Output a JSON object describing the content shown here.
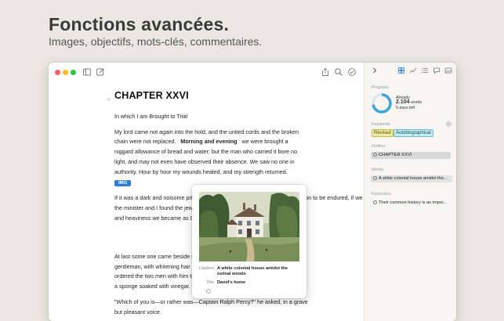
{
  "promo": {
    "title": "Fonctions avancées.",
    "subtitle": "Images, objectifs, mots-clés, commentaires."
  },
  "toolbar": {
    "left_icons": [
      "sidebar-icon",
      "compose-icon"
    ],
    "right_icons": [
      "share-icon",
      "search-icon",
      "checkmark-circle-icon"
    ]
  },
  "document": {
    "heading_marker": "##",
    "chapter_title": "CHAPTER XXVI",
    "subtitle": "In which I am Brought to Trial",
    "p1_part1": "My lord came not again into the hold, and the untied cords and the broken chain were not replaced.",
    "p1_marker": "*",
    "p1_bold": "Morning and evening",
    "p1_part2": "we were brought a niggard allowance of bread and water; but the man who carried it bore no light, and may not even have observed their absence. We saw no one in authority. Hour by hour my wounds healed, and my strength returned.",
    "img_tag": "IMG",
    "p2_line1": "If it was a dark and noisome prison, if there were hunger and thirst and inaction to be endured, if we knew not how",
    "p2_line2": "the minister and I found the jewel",
    "p2_line3": "and heaviness we became as Dav",
    "p3_line1": "At last some one came beside the",
    "p3_line2": "gentleman, with whitening hair and",
    "p3_line3": "ordered the two men with him to lo",
    "p3_line4": "a sponge soaked with vinegar.",
    "p4_line1": "\"Which of you is—or rather was—Captain Ralph Percy?\" he asked, in a grave",
    "p4_line2": "but pleasant voice."
  },
  "popover": {
    "caption_label": "Caption",
    "caption_value": "A white colonial house amidst the estival woods",
    "title_label": "Title",
    "title_value": "David's home"
  },
  "inspector": {
    "tab_icons": [
      "chevron-right-icon",
      "grid-icon",
      "chart-icon",
      "list-icon",
      "comment-icon",
      "image-icon"
    ],
    "progress_label": "Progress",
    "progress_already": "Already",
    "progress_words_value": "2.104",
    "progress_words_unit": "words",
    "progress_days": "5 days left",
    "progress_fraction": 0.72,
    "keywords_label": "Keywords",
    "keyword_1": "Revised",
    "keyword_2": "Autobiographical",
    "outline_label": "Outline",
    "outline_item": "CHAPTER XXVI",
    "media_label": "Media",
    "media_item": "A white colonial house amidst the...",
    "footnotes_label": "Footnotes",
    "footnote_item": "Their common history is an impor..."
  },
  "colors": {
    "accent": "#2e7cd6",
    "progress_ring": "#3da6d9",
    "keyword_revised": "#f0eca2",
    "keyword_autobiographical": "#c4ecf2",
    "traffic_red": "#ff5f57",
    "traffic_yellow": "#febc2e",
    "traffic_green": "#28c840"
  }
}
